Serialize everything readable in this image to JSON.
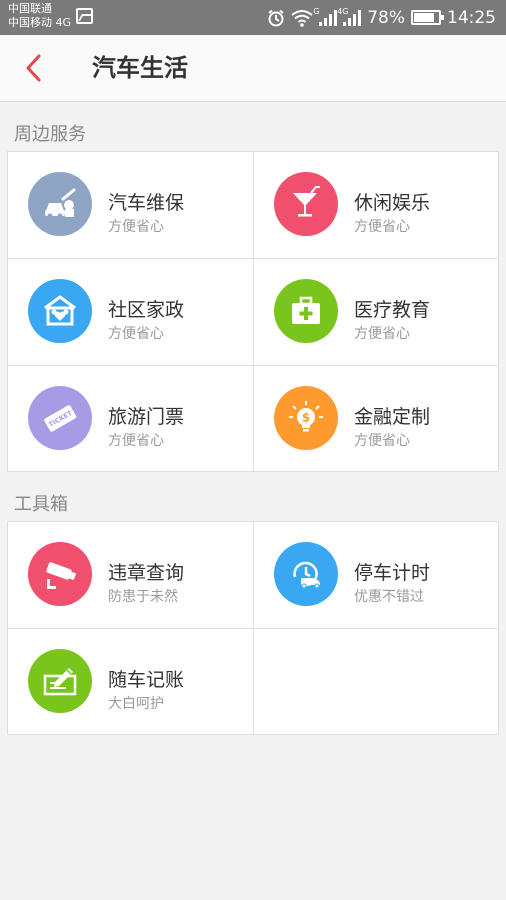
{
  "status_bar": {
    "carrier1": "中国联通",
    "carrier2": "中国移动 4G",
    "signal1_tag": "G",
    "signal2_tag": "4G",
    "battery": "78%",
    "time": "14:25"
  },
  "header": {
    "title": "汽车生活"
  },
  "sections": {
    "nearby": {
      "title": "周边服务"
    },
    "tools": {
      "title": "工具箱"
    }
  },
  "nearby_items": [
    {
      "title": "汽车维保",
      "subtitle": "方便省心",
      "color": "#8ea4c4",
      "icon": "car-repair-icon"
    },
    {
      "title": "休闲娱乐",
      "subtitle": "方便省心",
      "color": "#f0506e",
      "icon": "cocktail-icon"
    },
    {
      "title": "社区家政",
      "subtitle": "方便省心",
      "color": "#3aa7f2",
      "icon": "family-house-icon"
    },
    {
      "title": "医疗教育",
      "subtitle": "方便省心",
      "color": "#7ac51d",
      "icon": "medical-kit-icon"
    },
    {
      "title": "旅游门票",
      "subtitle": "方便省心",
      "color": "#a79be6",
      "icon": "ticket-icon"
    },
    {
      "title": "金融定制",
      "subtitle": "方便省心",
      "color": "#ff9a2e",
      "icon": "money-bulb-icon"
    }
  ],
  "ticket_text": "TICKET",
  "tool_items": [
    {
      "title": "违章查询",
      "subtitle": "防患于未然",
      "color": "#f0506e",
      "icon": "camera-icon"
    },
    {
      "title": "停车计时",
      "subtitle": "优惠不错过",
      "color": "#3aa7f2",
      "icon": "parking-timer-icon"
    },
    {
      "title": "随车记账",
      "subtitle": "大白呵护",
      "color": "#7ac51d",
      "icon": "notebook-pen-icon"
    }
  ]
}
